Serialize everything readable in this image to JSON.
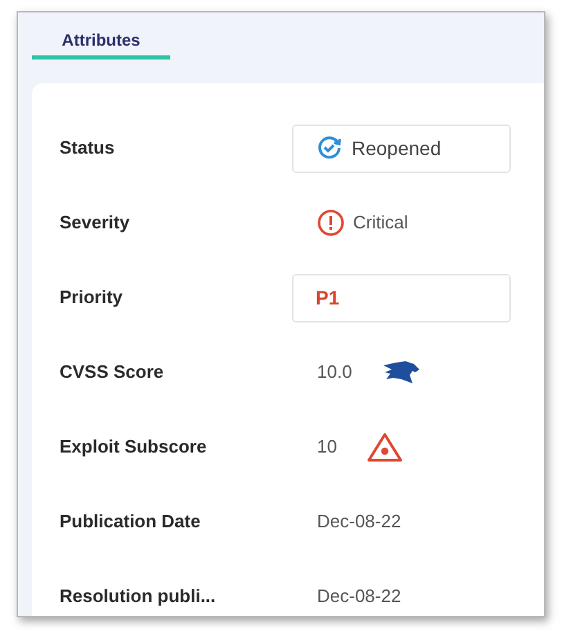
{
  "tabs": [
    {
      "label": "Attributes",
      "selected": true
    }
  ],
  "attributes": [
    {
      "label": "Status",
      "kind": "box",
      "value": "Reopened"
    },
    {
      "label": "Severity",
      "kind": "plain",
      "value": "Critical"
    },
    {
      "label": "Priority",
      "kind": "box",
      "value": "P1",
      "color": "#d9442b"
    },
    {
      "label": "CVSS Score",
      "kind": "plain",
      "value": "10.0"
    },
    {
      "label": "Exploit Subscore",
      "kind": "plain",
      "value": "10"
    },
    {
      "label": "Publication Date",
      "kind": "plain",
      "value": "Dec-08-22"
    },
    {
      "label": "Resolution publi...",
      "kind": "plain",
      "value": "Dec-08-22"
    }
  ]
}
